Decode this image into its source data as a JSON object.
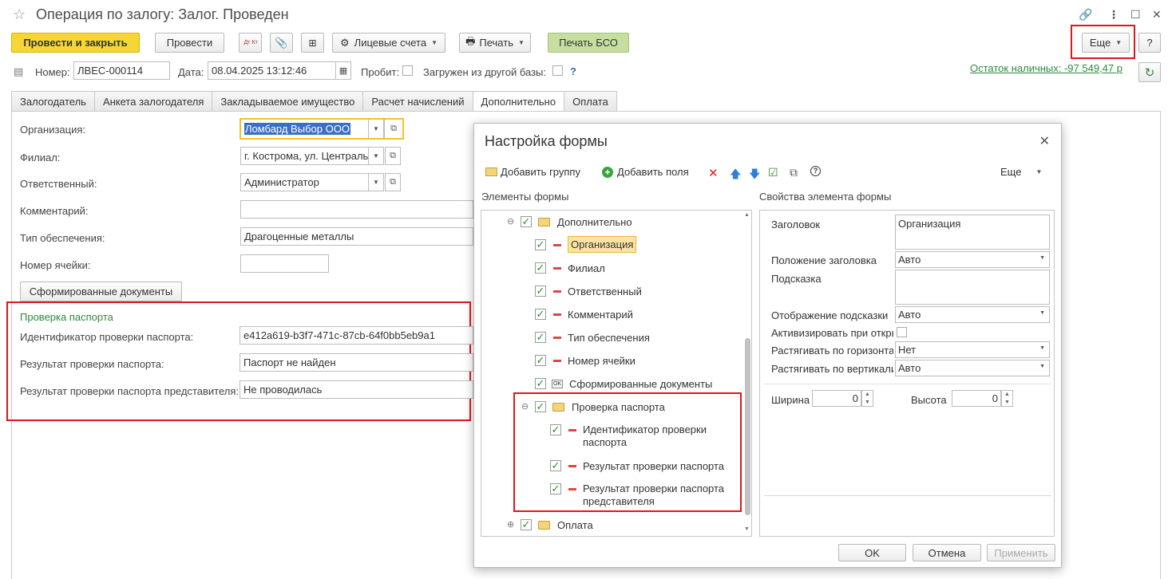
{
  "window": {
    "title": "Операция по залогу: Залог. Проведен"
  },
  "toolbar": {
    "post_close": "Провести и закрыть",
    "post": "Провести",
    "dt_kt": "Дт Кт",
    "accounts": "Лицевые счета",
    "print": "Печать",
    "print_bso": "Печать БСО",
    "more": "Еще",
    "help": "?"
  },
  "header": {
    "number_label": "Номер:",
    "number_value": "ЛВЕС-000114",
    "date_label": "Дата:",
    "date_value": "08.04.2025 13:12:46",
    "probit_label": "Пробит:",
    "loaded_label": "Загружен из другой базы:",
    "question": "?",
    "cash_balance": "Остаток наличных: -97 549,47 р"
  },
  "tabs": [
    "Залогодатель",
    "Анкета залогодателя",
    "Закладываемое имущество",
    "Расчет начислений",
    "Дополнительно",
    "Оплата"
  ],
  "form": {
    "org_label": "Организация:",
    "org_value": "Ломбард Выбор ООО",
    "branch_label": "Филиал:",
    "branch_value": "г. Кострома, ул. Централь",
    "resp_label": "Ответственный:",
    "resp_value": "Администратор",
    "comment_label": "Комментарий:",
    "type_label": "Тип обеспечения:",
    "type_value": "Драгоценные металлы",
    "cell_label": "Номер ячейки:",
    "docs_button": "Сформированные документы",
    "passport_section": "Проверка паспорта",
    "passport_id_label": "Идентификатор проверки паспорта:",
    "passport_id_value": "e412a619-b3f7-471c-87cb-64f0bb5eb9a1",
    "passport_result_label": "Результат проверки паспорта:",
    "passport_result_value": "Паспорт не найден",
    "rep_result_label": "Результат проверки паспорта представителя:",
    "rep_result_value": "Не проводилась"
  },
  "dialog": {
    "title": "Настройка формы",
    "add_group": "Добавить группу",
    "add_fields": "Добавить поля",
    "more": "Еще",
    "elements_header": "Элементы формы",
    "props_header": "Свойства элемента формы",
    "tree": [
      {
        "label": "Дополнительно",
        "kind": "folder"
      },
      {
        "label": "Организация",
        "kind": "field",
        "selected": true
      },
      {
        "label": "Филиал",
        "kind": "field"
      },
      {
        "label": "Ответственный",
        "kind": "field"
      },
      {
        "label": "Комментарий",
        "kind": "field"
      },
      {
        "label": "Тип обеспечения",
        "kind": "field"
      },
      {
        "label": "Номер ячейки",
        "kind": "field"
      },
      {
        "label": "Сформированные документы",
        "kind": "button"
      },
      {
        "label": "Проверка паспорта",
        "kind": "folder"
      },
      {
        "label": "Идентификатор проверки паспорта",
        "kind": "field"
      },
      {
        "label": "Результат проверки паспорта",
        "kind": "field"
      },
      {
        "label": "Результат проверки паспорта представителя",
        "kind": "field"
      },
      {
        "label": "Оплата",
        "kind": "folder"
      }
    ],
    "props": {
      "caption_label": "Заголовок",
      "caption_value": "Организация",
      "caption_pos_label": "Положение заголовка",
      "caption_pos_value": "Авто",
      "hint_label": "Подсказка",
      "hint_display_label": "Отображение подсказки",
      "hint_display_value": "Авто",
      "activate_label": "Активизировать при откры",
      "stretch_h_label": "Растягивать по горизонта",
      "stretch_h_value": "Нет",
      "stretch_v_label": "Растягивать по вертикали",
      "stretch_v_value": "Авто",
      "width_label": "Ширина",
      "width_value": "0",
      "height_label": "Высота",
      "height_value": "0"
    },
    "ok": "OK",
    "cancel": "Отмена",
    "apply": "Применить"
  }
}
